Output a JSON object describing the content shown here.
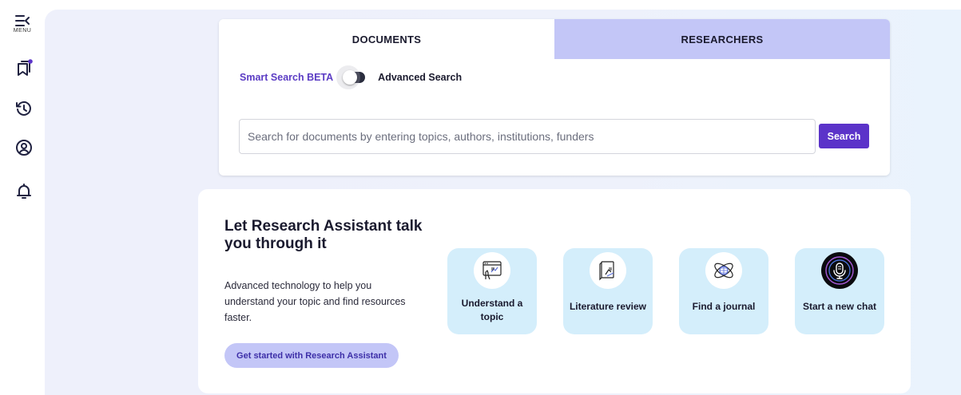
{
  "sidebar": {
    "menu_label": "MENU",
    "items": [
      {
        "icon": "bookmark-icon"
      },
      {
        "icon": "history-icon"
      },
      {
        "icon": "profile-icon"
      },
      {
        "icon": "bell-icon"
      }
    ]
  },
  "search": {
    "tabs": [
      {
        "label": "DOCUMENTS",
        "active": true
      },
      {
        "label": "RESEARCHERS",
        "active": false
      }
    ],
    "smart_search_label": "Smart Search BETA",
    "advanced_search_label": "Advanced Search",
    "placeholder": "Search for documents by entering topics, authors, institutions, funders",
    "value": "",
    "button_label": "Search"
  },
  "assistant": {
    "title": "Let Research Assistant talk you through it",
    "description": "Advanced technology to help you understand your topic and find resources faster.",
    "cta_label": "Get started with Research Assistant",
    "tiles": [
      {
        "label": "Understand a topic",
        "icon": "topic-screen-icon"
      },
      {
        "label": "Literature review",
        "icon": "document-review-icon"
      },
      {
        "label": "Find a journal",
        "icon": "atom-globe-icon"
      },
      {
        "label": "Start a new chat",
        "icon": "microphone-icon"
      }
    ]
  },
  "colors": {
    "accent": "#5b33c9",
    "tab_inactive": "#c3c6f7",
    "tile_bg": "#d4eefb",
    "page_bg": "#eef0fb"
  }
}
